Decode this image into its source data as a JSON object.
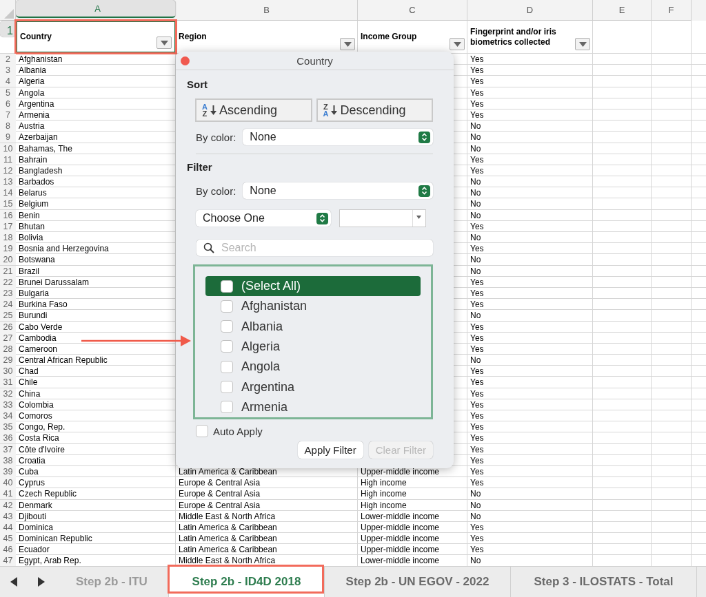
{
  "columns": [
    {
      "letter": "A",
      "selected": true
    },
    {
      "letter": "B",
      "selected": false
    },
    {
      "letter": "C",
      "selected": false
    },
    {
      "letter": "D",
      "selected": false
    },
    {
      "letter": "E",
      "selected": false
    },
    {
      "letter": "F",
      "selected": false
    }
  ],
  "header_row": {
    "number": "1",
    "selected": true,
    "cells": [
      {
        "text": "Country",
        "highlighted": true
      },
      {
        "text": "Region",
        "highlighted": false
      },
      {
        "text": "Income Group",
        "highlighted": false
      },
      {
        "text": "Fingerprint and/or iris biometrics collected",
        "highlighted": false
      }
    ]
  },
  "rows": [
    {
      "number": "2",
      "country": "Afghanistan",
      "biometrics": "Yes"
    },
    {
      "number": "3",
      "country": "Albania",
      "biometrics": "Yes"
    },
    {
      "number": "4",
      "country": "Algeria",
      "biometrics": "Yes"
    },
    {
      "number": "5",
      "country": "Angola",
      "biometrics": "Yes"
    },
    {
      "number": "6",
      "country": "Argentina",
      "biometrics": "Yes"
    },
    {
      "number": "7",
      "country": "Armenia",
      "biometrics": "Yes"
    },
    {
      "number": "8",
      "country": "Austria",
      "biometrics": "No"
    },
    {
      "number": "9",
      "country": "Azerbaijan",
      "biometrics": "No"
    },
    {
      "number": "10",
      "country": "Bahamas, The",
      "biometrics": "No"
    },
    {
      "number": "11",
      "country": "Bahrain",
      "biometrics": "Yes"
    },
    {
      "number": "12",
      "country": "Bangladesh",
      "biometrics": "Yes"
    },
    {
      "number": "13",
      "country": "Barbados",
      "biometrics": "No"
    },
    {
      "number": "14",
      "country": "Belarus",
      "biometrics": "No"
    },
    {
      "number": "15",
      "country": "Belgium",
      "biometrics": "No"
    },
    {
      "number": "16",
      "country": "Benin",
      "biometrics": "No"
    },
    {
      "number": "17",
      "country": "Bhutan",
      "biometrics": "Yes"
    },
    {
      "number": "18",
      "country": "Bolivia",
      "biometrics": "No"
    },
    {
      "number": "19",
      "country": "Bosnia and Herzegovina",
      "biometrics": "Yes"
    },
    {
      "number": "20",
      "country": "Botswana",
      "biometrics": "No"
    },
    {
      "number": "21",
      "country": "Brazil",
      "biometrics": "No"
    },
    {
      "number": "22",
      "country": "Brunei Darussalam",
      "biometrics": "Yes"
    },
    {
      "number": "23",
      "country": "Bulgaria",
      "biometrics": "Yes"
    },
    {
      "number": "24",
      "country": "Burkina Faso",
      "biometrics": "Yes"
    },
    {
      "number": "25",
      "country": "Burundi",
      "biometrics": "No"
    },
    {
      "number": "26",
      "country": "Cabo Verde",
      "biometrics": "Yes"
    },
    {
      "number": "27",
      "country": "Cambodia",
      "biometrics": "Yes"
    },
    {
      "number": "28",
      "country": "Cameroon",
      "biometrics": "Yes"
    },
    {
      "number": "29",
      "country": "Central African Republic",
      "biometrics": "No"
    },
    {
      "number": "30",
      "country": "Chad",
      "biometrics": "Yes"
    },
    {
      "number": "31",
      "country": "Chile",
      "biometrics": "Yes"
    },
    {
      "number": "32",
      "country": "China",
      "biometrics": "Yes"
    },
    {
      "number": "33",
      "country": "Colombia",
      "biometrics": "Yes"
    },
    {
      "number": "34",
      "country": "Comoros",
      "biometrics": "Yes"
    },
    {
      "number": "35",
      "country": "Congo, Rep.",
      "biometrics": "Yes"
    },
    {
      "number": "36",
      "country": "Costa Rica",
      "biometrics": "Yes"
    },
    {
      "number": "37",
      "country": "Côte d'Ivoire",
      "biometrics": "Yes"
    },
    {
      "number": "38",
      "country": "Croatia",
      "biometrics": "Yes"
    },
    {
      "number": "39",
      "country": "Cuba",
      "region": "Latin America & Caribbean",
      "income_group": "Upper-middle income",
      "biometrics": "Yes"
    },
    {
      "number": "40",
      "country": "Cyprus",
      "region": "Europe & Central Asia",
      "income_group": "High income",
      "biometrics": "Yes"
    },
    {
      "number": "41",
      "country": "Czech Republic",
      "region": "Europe & Central Asia",
      "income_group": "High income",
      "biometrics": "No"
    },
    {
      "number": "42",
      "country": "Denmark",
      "region": "Europe & Central Asia",
      "income_group": "High income",
      "biometrics": "No"
    },
    {
      "number": "43",
      "country": "Djibouti",
      "region": "Middle East & North Africa",
      "income_group": "Lower-middle income",
      "biometrics": "No"
    },
    {
      "number": "44",
      "country": "Dominica",
      "region": "Latin America & Caribbean",
      "income_group": "Upper-middle income",
      "biometrics": "Yes"
    },
    {
      "number": "45",
      "country": "Dominican Republic",
      "region": "Latin America & Caribbean",
      "income_group": "Upper-middle income",
      "biometrics": "Yes"
    },
    {
      "number": "46",
      "country": "Ecuador",
      "region": "Latin America & Caribbean",
      "income_group": "Upper-middle income",
      "biometrics": "Yes"
    },
    {
      "number": "47",
      "country": "Egypt, Arab Rep.",
      "region": "Middle East & North Africa",
      "income_group": "Lower-middle income",
      "biometrics": "No"
    }
  ],
  "filter_popup": {
    "title": "Country",
    "sort_heading": "Sort",
    "sort_buttons": [
      {
        "label": "Ascending",
        "icon_top": "A",
        "icon_bottom": "Z"
      },
      {
        "label": "Descending",
        "icon_top": "Z",
        "icon_bottom": "A"
      }
    ],
    "sort_by_color": {
      "label": "By color:",
      "value": "None"
    },
    "filter_heading": "Filter",
    "filter_by_color": {
      "label": "By color:",
      "value": "None"
    },
    "condition": {
      "value": "Choose One"
    },
    "search": {
      "placeholder": "Search"
    },
    "items": [
      {
        "label": "(Select All)",
        "checked": false,
        "selected": true
      },
      {
        "label": "Afghanistan",
        "checked": false,
        "selected": false
      },
      {
        "label": "Albania",
        "checked": false,
        "selected": false
      },
      {
        "label": "Algeria",
        "checked": false,
        "selected": false
      },
      {
        "label": "Angola",
        "checked": false,
        "selected": false
      },
      {
        "label": "Argentina",
        "checked": false,
        "selected": false
      },
      {
        "label": "Armenia",
        "checked": false,
        "selected": false
      }
    ],
    "auto_apply": {
      "label": "Auto Apply",
      "checked": false
    },
    "buttons": [
      {
        "label": "Apply Filter",
        "disabled": false
      },
      {
        "label": "Clear Filter",
        "disabled": true
      }
    ]
  },
  "sheet_tabs": [
    {
      "label": "Step 2b - ITU",
      "selected": false,
      "highlighted": false
    },
    {
      "label": "Step 2b - ID4D 2018",
      "selected": true,
      "highlighted": true
    },
    {
      "label": "Step 2b - UN EGOV - 2022",
      "selected": false,
      "highlighted": false
    },
    {
      "label": "Step 3 - ILOSTATS - Total",
      "selected": false,
      "highlighted": false
    }
  ]
}
